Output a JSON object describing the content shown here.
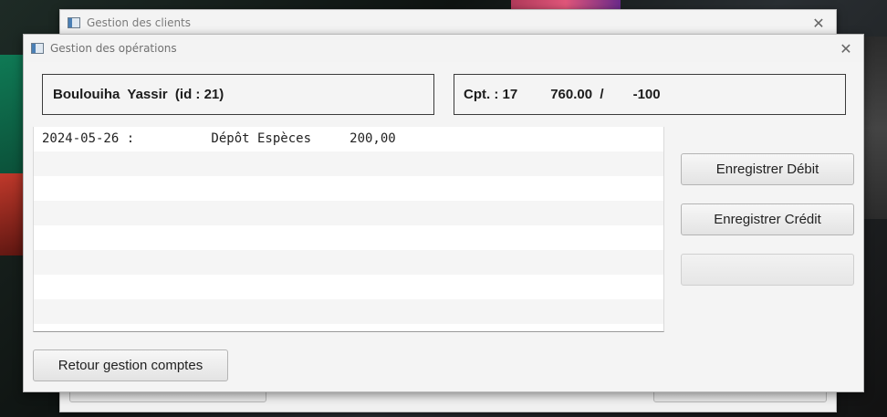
{
  "back_window": {
    "title": "Gestion des clients",
    "close_symbol": "✕"
  },
  "front_window": {
    "title": "Gestion des opérations",
    "close_symbol": "✕"
  },
  "client_info": {
    "text": "Boulouiha  Yassir  (id : 21)"
  },
  "account_info": {
    "account_label": "Cpt. : 17",
    "balance": "760.00  /",
    "overdraft": "-100"
  },
  "operations": {
    "rows": [
      "2024-05-26 :          Dépôt Espèces     200,00",
      "",
      "",
      "",
      "",
      "",
      "",
      ""
    ]
  },
  "buttons": {
    "debit": "Enregistrer Débit",
    "credit": "Enregistrer Crédit",
    "blank": "",
    "back": "Retour gestion comptes"
  },
  "icons": {
    "window_icon": "application-window-icon",
    "close_icon": "close-icon"
  }
}
